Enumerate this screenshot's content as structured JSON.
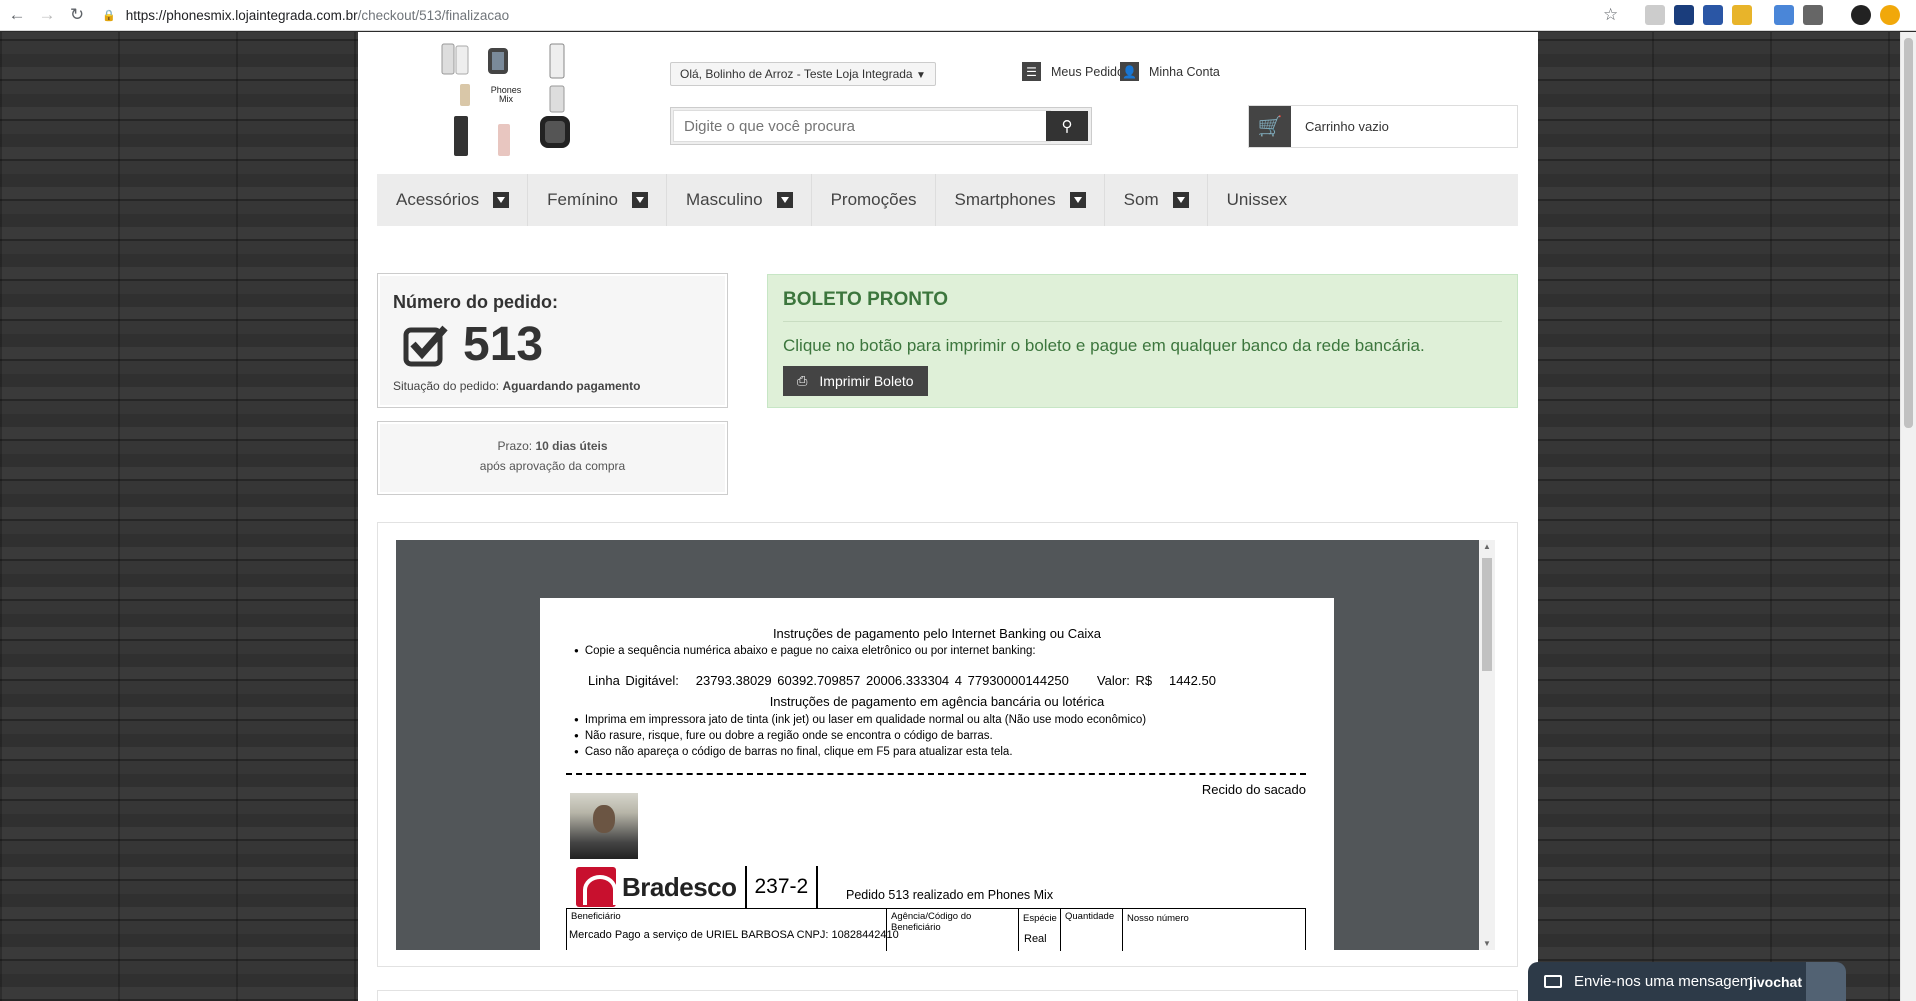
{
  "browser": {
    "host": "https://phonesmix.lojaintegrada.com.br",
    "path": "/checkout/513/finalizacao"
  },
  "header": {
    "logo_text": "Phones Mix",
    "greeting": "Olá, Bolinho de Arroz - Teste Loja Integrada",
    "search_placeholder": "Digite o que você procura",
    "orders_label": "Meus Pedidos",
    "account_label": "Minha Conta",
    "cart_label": "Carrinho vazio"
  },
  "menu": [
    "Acessórios",
    "Femínino",
    "Masculino",
    "Promoções",
    "Smartphones",
    "Som",
    "Unissex"
  ],
  "order": {
    "title": "Número do pedido:",
    "number": "513",
    "status_prefix": "Situação do pedido:",
    "status": "Aguardando pagamento",
    "prazo_prefix": "Prazo:",
    "prazo": "10 dias úteis",
    "prazo_note": "após aprovação da compra"
  },
  "boleto": {
    "title": "BOLETO PRONTO",
    "text": "Clique no botão para imprimir o boleto e pague em qualquer banco da rede bancária.",
    "button": "Imprimir Boleto"
  },
  "doc": {
    "h1": "Instruções de pagamento pelo Internet Banking ou Caixa",
    "b1": "Copie a sequência numérica abaixo e pague no caixa eletrônico ou por internet banking:",
    "linha_label": "Linha Digitável:",
    "linha": "23793.38029 60392.709857 20006.333304 4 77930000144250",
    "valor_label": "Valor: R$",
    "valor": "1442.50",
    "h2": "Instruções de pagamento em agência bancária ou lotérica",
    "b2": "Imprima em impressora jato de tinta (ink jet) ou laser em qualidade normal ou alta (Não use modo econômico)",
    "b3": "Não rasure, risque, fure ou dobre a região onde se encontra o código de barras.",
    "b4": "Caso não apareça o código de barras no final, clique em F5 para atualizar esta tela.",
    "recido": "Recido do sacado",
    "bank": "Bradesco",
    "bank_code": "237-2",
    "pedido": "Pedido 513 realizado em Phones Mix",
    "col_beneficiario": "Beneficiário",
    "val_beneficiario": "Mercado Pago a serviço de URIEL BARBOSA CNPJ: 10828442410",
    "col_agencia": "Agência/Código do Beneficiário",
    "col_especie": "Espécie",
    "val_especie": "Real",
    "col_quantidade": "Quantidade",
    "col_nosso": "Nosso número"
  },
  "chat": {
    "label": "Envie-nos uma mensagem",
    "brand": "jivochat"
  }
}
